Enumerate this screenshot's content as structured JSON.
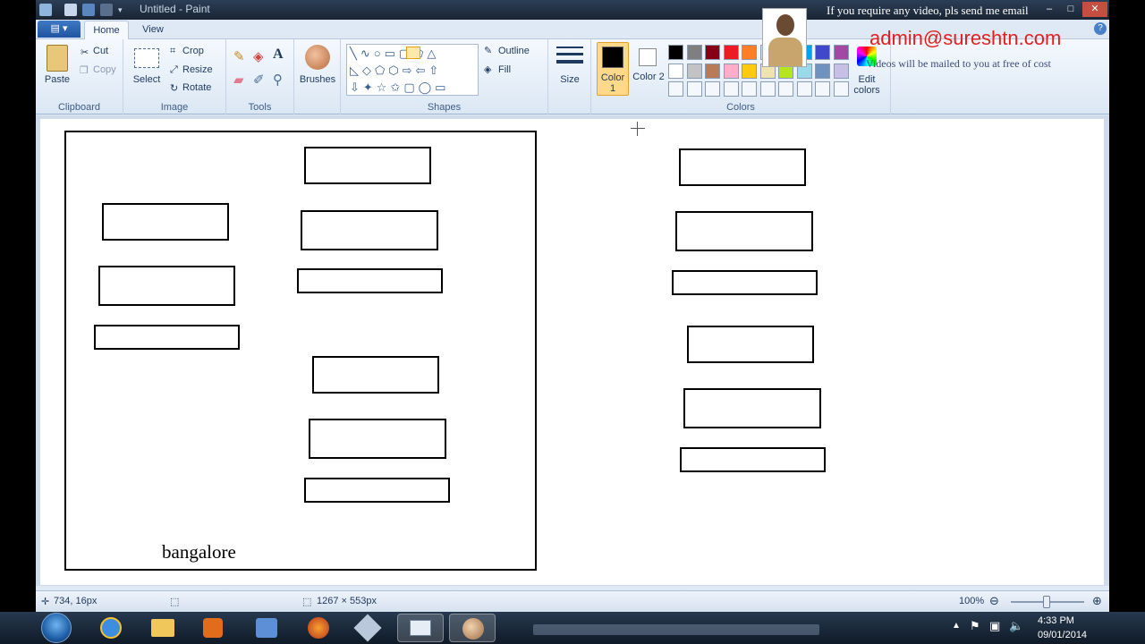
{
  "window": {
    "title": "Untitled - Paint",
    "watermark_text": "If you require any video, pls send me email",
    "controls": {
      "minimize": "–",
      "maximize": "□",
      "close": "✕"
    }
  },
  "menu": {
    "app_button": "▤ ▾",
    "tabs": [
      {
        "label": "Home"
      },
      {
        "label": "View"
      }
    ],
    "help": "?"
  },
  "ribbon": {
    "clipboard": {
      "paste": "Paste",
      "cut": "Cut",
      "copy": "Copy",
      "group_label": "Clipboard"
    },
    "image": {
      "select": "Select",
      "crop": "Crop",
      "resize": "Resize",
      "rotate": "Rotate",
      "group_label": "Image"
    },
    "tools": {
      "group_label": "Tools"
    },
    "brushes": {
      "label": "Brushes"
    },
    "shapes": {
      "outline": "Outline",
      "fill": "Fill",
      "group_label": "Shapes"
    },
    "size": {
      "label": "Size"
    },
    "colors": {
      "color1_label": "Color 1",
      "color2_label": "Color 2",
      "edit_colors": "Edit colors",
      "group_label": "Colors",
      "color1": "#000000",
      "color2": "#ffffff",
      "palette_row1": [
        "#000000",
        "#7f7f7f",
        "#880015",
        "#ed1c24",
        "#ff7f27",
        "#fff200",
        "#22b14c",
        "#00a2e8",
        "#3f48cc",
        "#a349a4"
      ],
      "palette_row2": [
        "#ffffff",
        "#c3c3c3",
        "#b97a57",
        "#ffaec9",
        "#ffc90e",
        "#efe4b0",
        "#b5e61d",
        "#99d9ea",
        "#7092be",
        "#c8bfe7"
      ]
    }
  },
  "canvas": {
    "caption": "bangalore"
  },
  "statusbar": {
    "cursor_position": "734, 16px",
    "canvas_size": "1267 × 553px",
    "zoom": "100%"
  },
  "taskbar": {
    "time": "4:33 PM",
    "date": "09/01/2014"
  },
  "overlay": {
    "email": "admin@sureshtn.com",
    "note": "Videos will be mailed to you at free of cost"
  }
}
